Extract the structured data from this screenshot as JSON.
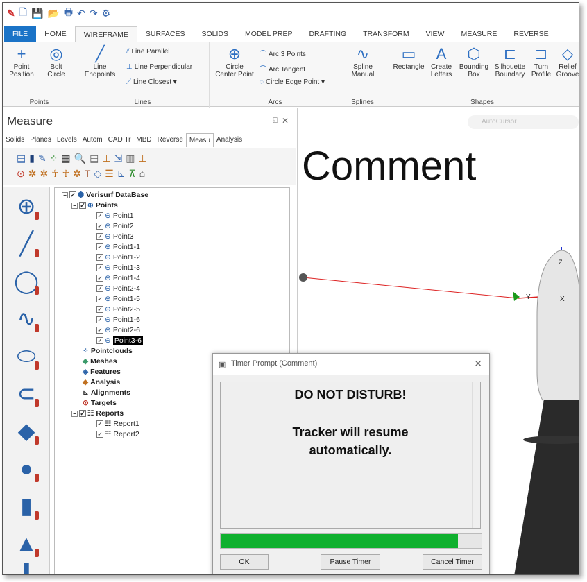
{
  "ribbon_tabs": [
    "FILE",
    "HOME",
    "WIREFRAME",
    "SURFACES",
    "SOLIDS",
    "MODEL PREP",
    "DRAFTING",
    "TRANSFORM",
    "VIEW",
    "MEASURE",
    "REVERSE"
  ],
  "ribbon": {
    "points": {
      "label": "Points",
      "point_position": "Point\nPosition",
      "bolt_circle": "Bolt\nCircle"
    },
    "lines": {
      "label": "Lines",
      "line_endpoints": "Line\nEndpoints",
      "line_parallel": "Line Parallel",
      "line_perpendicular": "Line Perpendicular",
      "line_closest": "Line Closest"
    },
    "arcs": {
      "label": "Arcs",
      "circle_center_point": "Circle\nCenter Point",
      "arc_3_points": "Arc 3 Points",
      "arc_tangent": "Arc Tangent",
      "circle_edge_point": "Circle Edge Point"
    },
    "splines": {
      "label": "Splines",
      "spline_manual": "Spline\nManual"
    },
    "shapes": {
      "label": "Shapes",
      "rectangle": "Rectangle",
      "create_letters": "Create\nLetters",
      "bounding_box": "Bounding\nBox",
      "silhouette_boundary": "Silhouette\nBoundary",
      "turn_profile": "Turn\nProfile",
      "relief_groove": "Relief\nGroove"
    }
  },
  "panel": {
    "title": "Measure",
    "pin": "⍇",
    "close": "✕",
    "tabs": [
      "Solids",
      "Planes",
      "Levels",
      "Autom",
      "CAD Tr",
      "MBD",
      "Reverse",
      "Measu",
      "Analysis"
    ]
  },
  "tree": {
    "root": "Verisurf DataBase",
    "points_label": "Points",
    "points": [
      "Point1",
      "Point2",
      "Point3",
      "Point1-1",
      "Point1-2",
      "Point1-3",
      "Point1-4",
      "Point2-4",
      "Point1-5",
      "Point2-5",
      "Point1-6",
      "Point2-6",
      "Point3-6"
    ],
    "categories": [
      "Pointclouds",
      "Meshes",
      "Features",
      "Analysis",
      "Alignments",
      "Targets"
    ],
    "reports_label": "Reports",
    "reports": [
      "Report1",
      "Report2"
    ]
  },
  "viewport": {
    "comment_text": "Comment",
    "autocursor": "AutoCursor",
    "axis_y": "Y",
    "axis_x": "X",
    "axis_z": "Z"
  },
  "dialog": {
    "title": "Timer Prompt (Comment)",
    "message_line1": "DO NOT DISTURB!",
    "message_line2": "Tracker will resume",
    "message_line3": "automatically.",
    "progress": 0.91,
    "ok": "OK",
    "pause": "Pause Timer",
    "cancel": "Cancel Timer"
  },
  "colors": {
    "file_tab": "#1a73c7",
    "progress_fill": "#0fb02e",
    "accent": "#2d6fc2"
  }
}
